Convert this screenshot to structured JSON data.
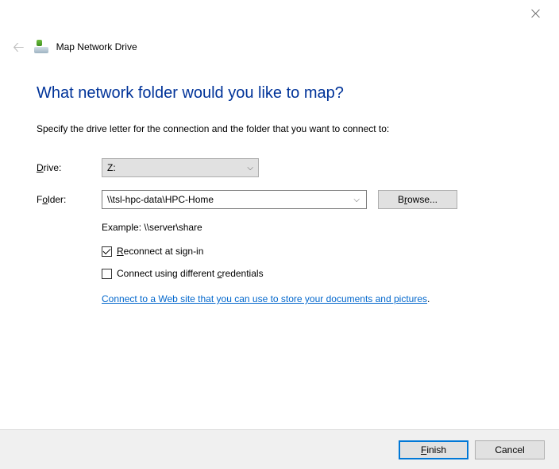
{
  "window": {
    "title": "Map Network Drive"
  },
  "heading": "What network folder would you like to map?",
  "subtext": "Specify the drive letter for the connection and the folder that you want to connect to:",
  "labels": {
    "drive_pre": "D",
    "drive_mid": "rive:",
    "folder_pre": "F",
    "folder_mid": "o",
    "folder_post": "lder:"
  },
  "drive": {
    "selected": "Z:"
  },
  "folder": {
    "value": "\\\\tsl-hpc-data\\HPC-Home",
    "example": "Example: \\\\server\\share"
  },
  "buttons": {
    "browse_pre": "B",
    "browse_mid": "r",
    "browse_post": "owse...",
    "finish_pre": "F",
    "finish_mid": "inish",
    "cancel": "Cancel"
  },
  "checkboxes": {
    "reconnect_pre": "R",
    "reconnect_post": "econnect at sign-in",
    "creds_pre": "Connect using different ",
    "creds_mid": "c",
    "creds_post": "redentials"
  },
  "link": {
    "text_pre": "Connect to a Web site that you can use to store your documents and pictures",
    "text_post": "."
  }
}
